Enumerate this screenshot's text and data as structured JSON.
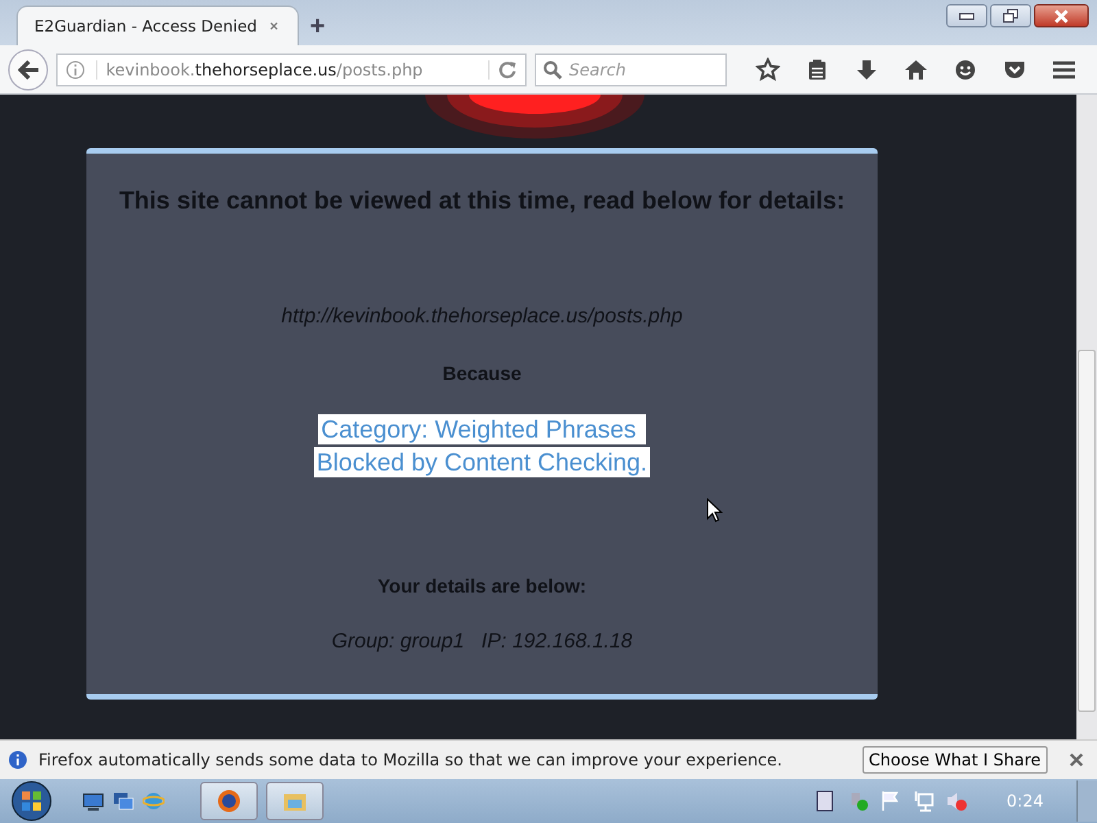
{
  "tabs": [
    {
      "label": "E2Guardian - Access Denied",
      "selected": true
    }
  ],
  "new_tab": {
    "label": "+"
  },
  "address_bar": {
    "url_prefix": "kevinbook.",
    "url_domain": "thehorseplace.us",
    "url_path": "/posts.php"
  },
  "search": {
    "placeholder": "Search"
  },
  "page": {
    "heading": "This site cannot be viewed at this time, read below for details:",
    "blocked_url": "http://kevinbook.thehorseplace.us/posts.php",
    "because": "Because",
    "reason_lines": [
      {
        "text": "Category: Weighted Phrases ",
        "selected": true
      },
      {
        "text": "Blocked by Content Checking.",
        "selected": true
      }
    ],
    "details_heading": "Your details are below:",
    "details": "Group: group1   IP: 192.168.1.18"
  },
  "notification": {
    "message": "Firefox automatically sends some data to Mozilla so that we can improve your experience.",
    "button": "Choose What I Share"
  },
  "taskbar": {
    "clock": "0:24"
  }
}
